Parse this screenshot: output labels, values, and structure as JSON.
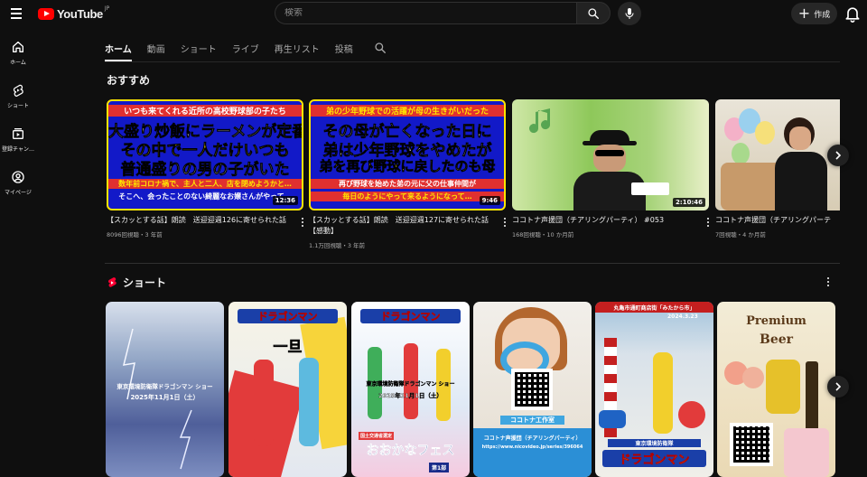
{
  "header": {
    "logo_text": "YouTube",
    "region": "JP",
    "search_placeholder": "検索",
    "create_label": "作成"
  },
  "sidebar": {
    "items": [
      {
        "label": "ホーム",
        "icon": "home-icon"
      },
      {
        "label": "ショート",
        "icon": "shorts-icon"
      },
      {
        "label": "登録チャン…",
        "icon": "subscriptions-icon"
      },
      {
        "label": "マイページ",
        "icon": "you-icon"
      }
    ]
  },
  "tabs": [
    "ホーム",
    "動画",
    "ショート",
    "ライブ",
    "再生リスト",
    "投稿"
  ],
  "recommended": {
    "title": "おすすめ",
    "videos": [
      {
        "title": "【スカッとする話】朗読　送迎迎週126に寄せられた話",
        "meta": "8096回視聴・3 年前",
        "duration": "12:36",
        "captions": [
          "いつも来てくれる近所の高校野球部の子たち",
          "大盛り炒飯にラーメンが定番",
          "その中で一人だけいつも",
          "普通盛りの男の子がいた",
          "数年前コロナ禍で、主人と二人、店を閉めようかと…",
          "そこへ、会ったことのない綺麗なお嬢さんがやって…"
        ]
      },
      {
        "title": "【スカッとする話】朗読　送迎迎週127に寄せられた話【感動】",
        "meta": "1.1万回視聴・3 年前",
        "duration": "9:46",
        "captions": [
          "弟の少年野球での活躍が母の生きがいだった",
          "その母が亡くなった日に",
          "弟は少年野球をやめたが",
          "弟を再び野球に戻したのも母",
          "再び野球を始めた弟の元に父の仕事仲間が",
          "毎日のようにやって来るようになって…"
        ]
      },
      {
        "title": "ココトナ声援団（チアリングパーティ） #053",
        "meta": "168回視聴・10 か月前",
        "duration": "2:10:46",
        "captions": []
      },
      {
        "title": "ココトナ声援団（チアリングパーテ",
        "meta": "7回視聴・4 か月前",
        "duration": "",
        "captions": []
      }
    ]
  },
  "shorts": {
    "title": "ショート",
    "items": [
      {
        "captions": [
          "東京環境防衛隊ドラゴンマン ショー",
          "2025年11月1日（土）"
        ]
      },
      {
        "captions": [
          "ドラゴンマン",
          "一旦"
        ]
      },
      {
        "captions": [
          "ドラゴンマン",
          "東京環境防衛隊ドラゴンマン ショー",
          "2025年11月1日（土）",
          "おおかなフェス",
          "国土交通省選定",
          "第1部"
        ]
      },
      {
        "captions": [
          "ココトナ工作室",
          "ココトナ声援団（チアリングパーティ）",
          "https://www.nicovideo.jp/series/396064"
        ]
      },
      {
        "captions": [
          "丸亀市通町商店街「みたから市」",
          "2024.3.23",
          "東京環境防衛隊",
          "ドラゴンマン"
        ]
      },
      {
        "captions": [
          "Premium",
          "Beer"
        ]
      }
    ]
  },
  "colors": {
    "background": "#0f0f0f",
    "brand_red": "#ff0000",
    "text_primary": "#f1f1f1",
    "text_secondary": "#aaaaaa"
  }
}
